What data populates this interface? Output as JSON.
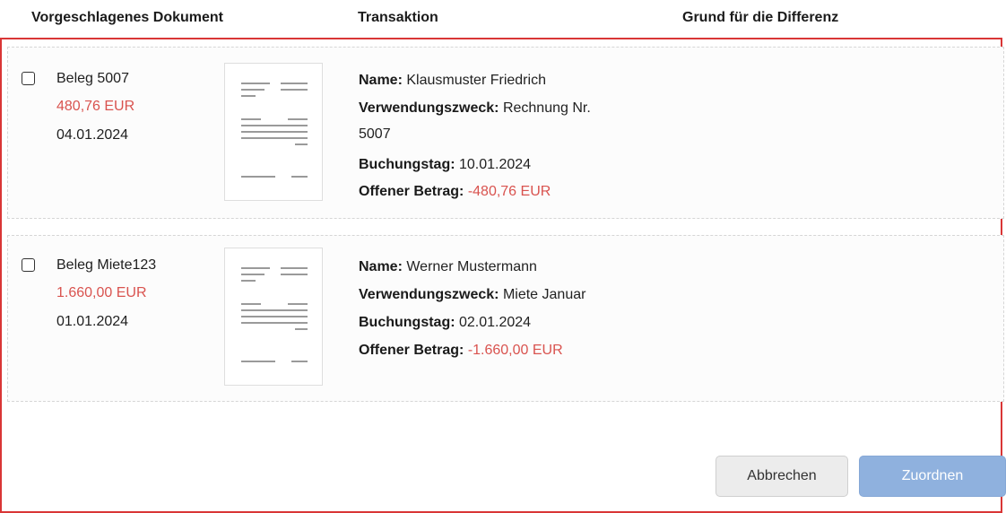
{
  "headers": {
    "document": "Vorgeschlagenes Dokument",
    "transaction": "Transaktion",
    "reason": "Grund für die Differenz"
  },
  "rows": [
    {
      "beleg": "Beleg 5007",
      "amount": "480,76 EUR",
      "date": "04.01.2024",
      "name_label": "Name:",
      "name": "Klausmuster Friedrich",
      "purpose_label": "Verwendungszweck:",
      "purpose_line1": "Rechnung Nr.",
      "purpose_line2": "5007",
      "booking_label": "Buchungstag:",
      "booking_date": "10.01.2024",
      "open_label": "Offener Betrag:",
      "open_amount": "-480,76 EUR"
    },
    {
      "beleg": "Beleg Miete123",
      "amount": "1.660,00 EUR",
      "date": "01.01.2024",
      "name_label": "Name:",
      "name": "Werner Mustermann",
      "purpose_label": "Verwendungszweck:",
      "purpose_line1": "Miete Januar",
      "booking_label": "Buchungstag:",
      "booking_date": "02.01.2024",
      "open_label": "Offener Betrag:",
      "open_amount": "-1.660,00 EUR"
    }
  ],
  "buttons": {
    "cancel": "Abbrechen",
    "assign": "Zuordnen"
  },
  "colors": {
    "highlight_border": "#d93636",
    "amount_red": "#d9534f",
    "primary_disabled": "#8fb1de"
  },
  "icons": {
    "document_thumbnail": "document-preview-icon",
    "checkbox": "checkbox-unchecked-icon"
  }
}
